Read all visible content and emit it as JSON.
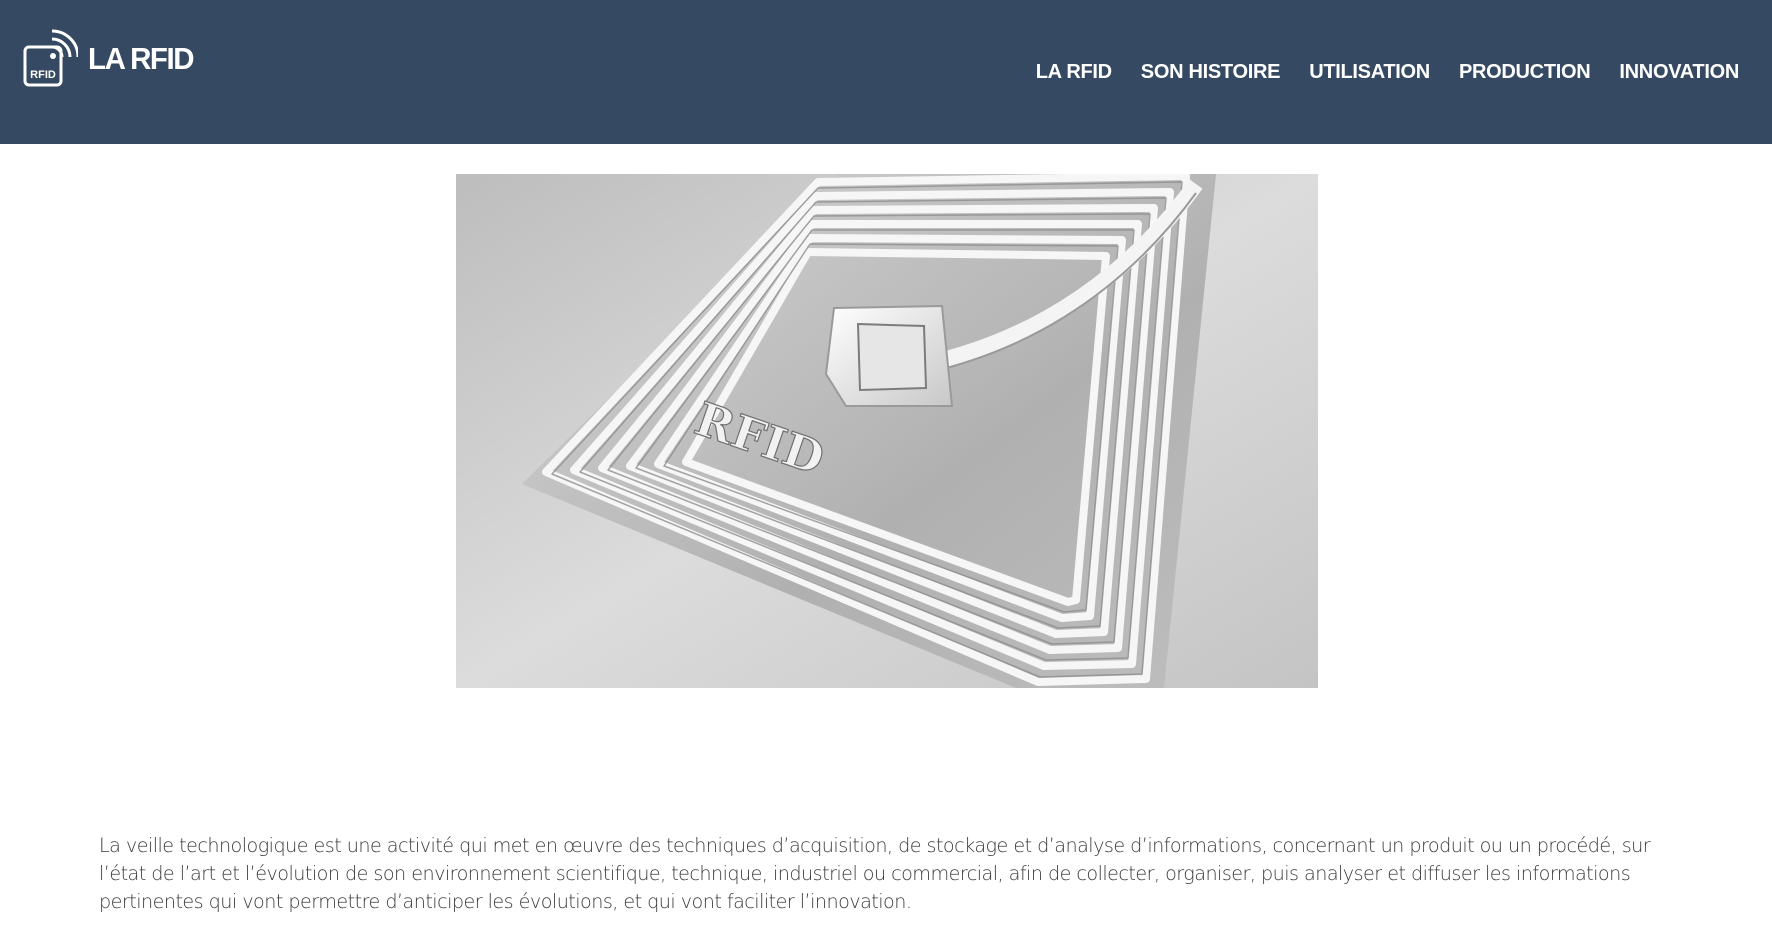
{
  "header": {
    "brand": {
      "logo_icon": "rfid-tag-icon",
      "logo_label": "RFID",
      "title": "LA RFID"
    },
    "nav": [
      {
        "label": "LA RFID"
      },
      {
        "label": "SON HISTOIRE"
      },
      {
        "label": "UTILISATION"
      },
      {
        "label": "PRODUCTION"
      },
      {
        "label": "INNOVATION"
      }
    ],
    "background_color": "#354a62"
  },
  "hero": {
    "image_icon": "rfid-antenna-photo",
    "tag_text": "RFID"
  },
  "intro": {
    "text": "La veille technologique est une activité qui met en œuvre des techniques d’acquisition, de stockage et d’analyse d’informations, concernant un produit ou un procédé, sur l’état de l’art et l’évolution de son environnement scientifique, technique, industriel ou commercial, afin de collecter, organiser, puis analyser et diffuser les informations pertinentes qui vont permettre d’anticiper les évolutions, et qui vont faciliter l’innovation."
  }
}
